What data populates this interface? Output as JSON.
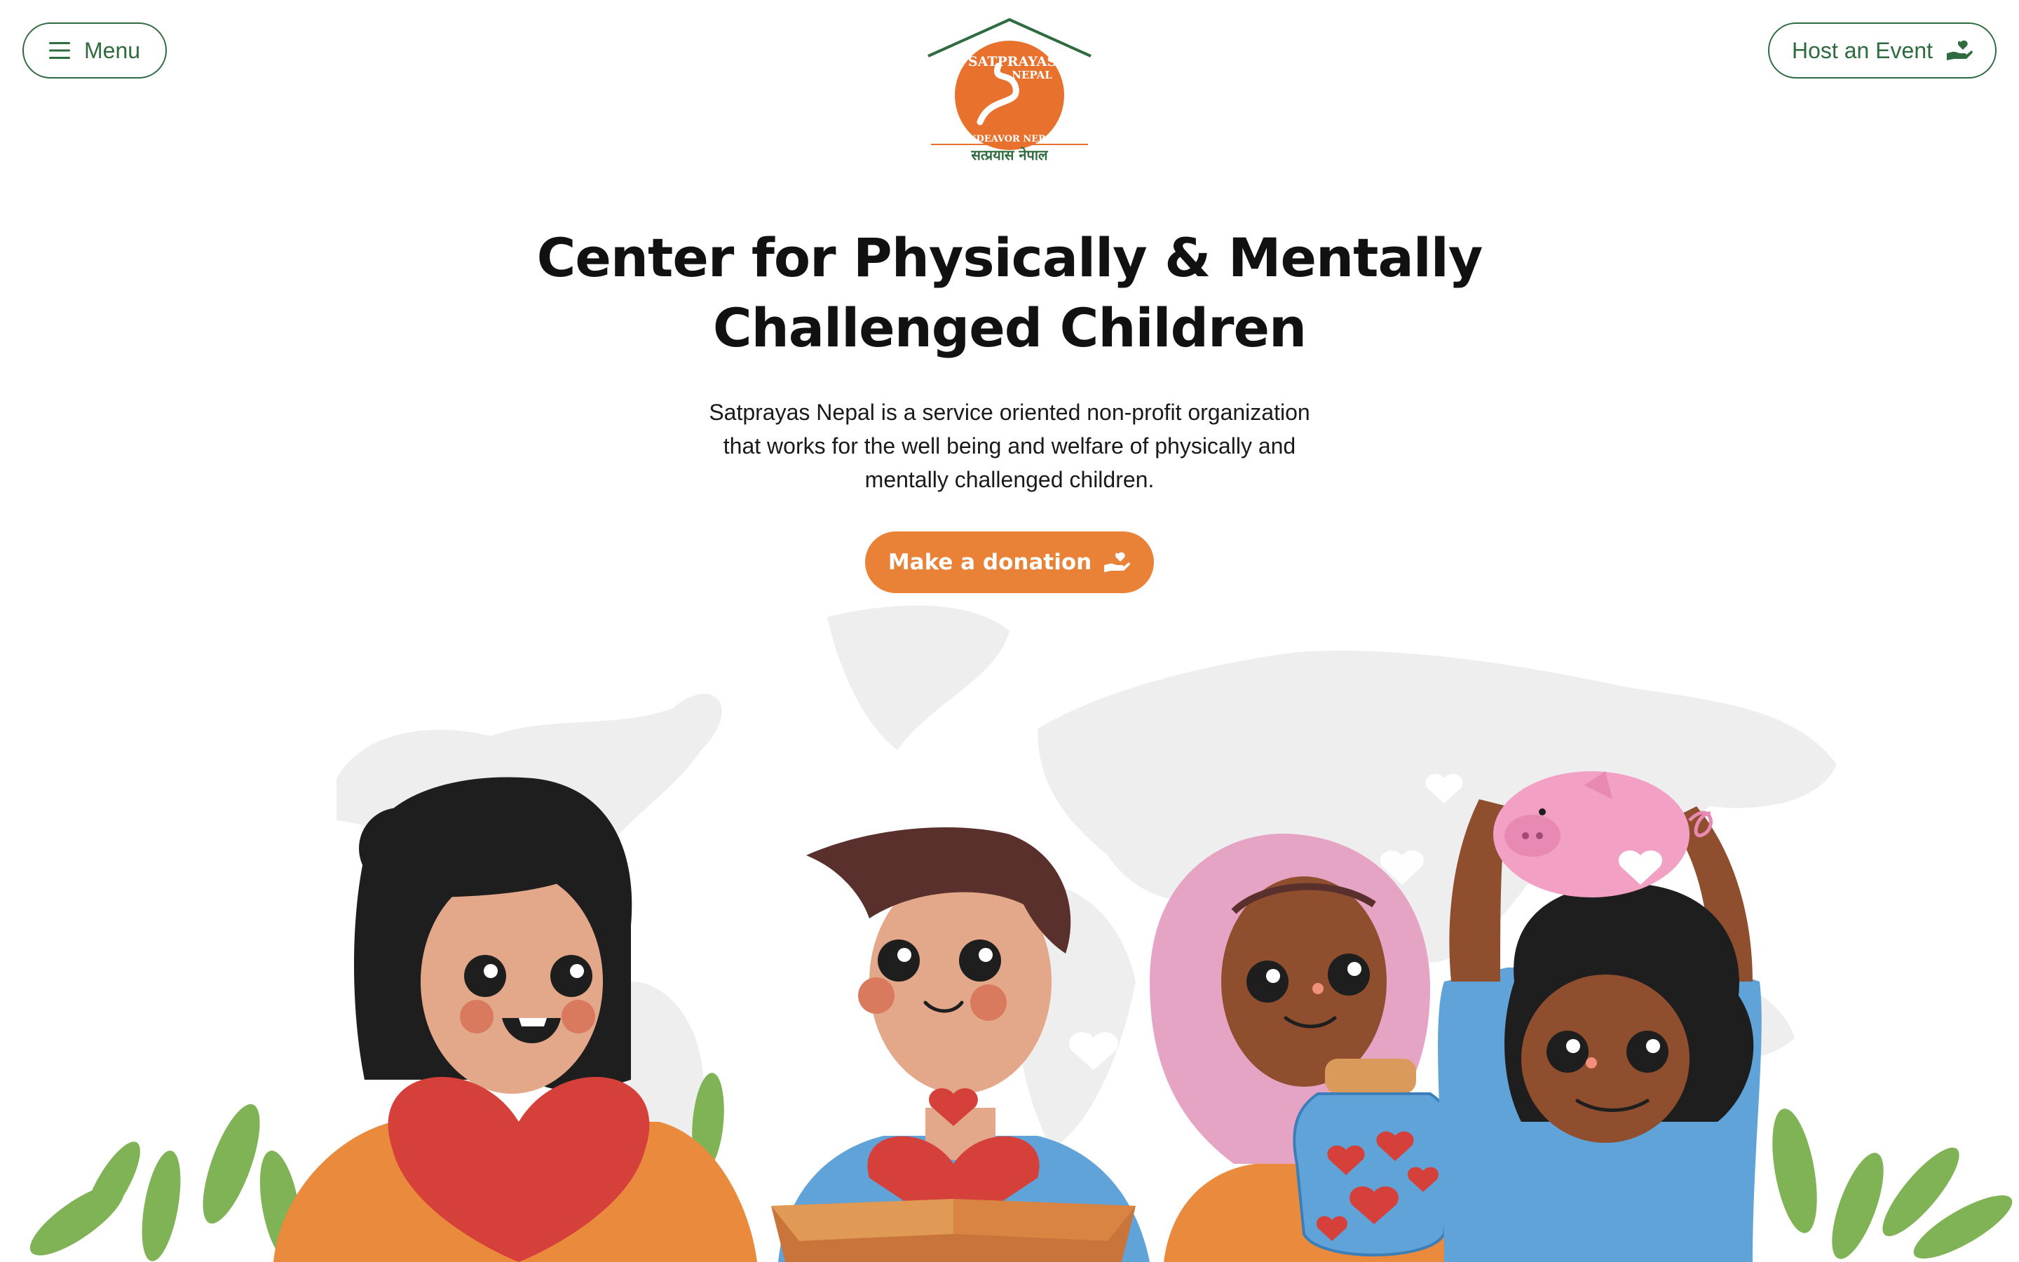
{
  "header": {
    "menu_label": "Menu",
    "host_label": "Host an Event",
    "logo": {
      "name_line1": "SATPRAYAS",
      "name_line2": "NEPAL",
      "arc_text": "ENDEAVOR NEPAL",
      "devanagari": "सत्प्रयास नेपाल"
    }
  },
  "hero": {
    "title_line1": "Center for Physically & Mentally",
    "title_line2": "Challenged Children",
    "description": "Satprayas Nepal is a service oriented non-profit organization that works for the well being and welfare of physically and mentally challenged children.",
    "cta_label": "Make a donation"
  },
  "colors": {
    "brand_green": "#2e6b3e",
    "accent_orange": "#e98237",
    "heart_red": "#d6403b",
    "map_gray": "#eeeeee"
  },
  "icons": {
    "menu": "hamburger-icon",
    "host": "heart-hand-icon",
    "donate": "heart-hand-icon"
  }
}
